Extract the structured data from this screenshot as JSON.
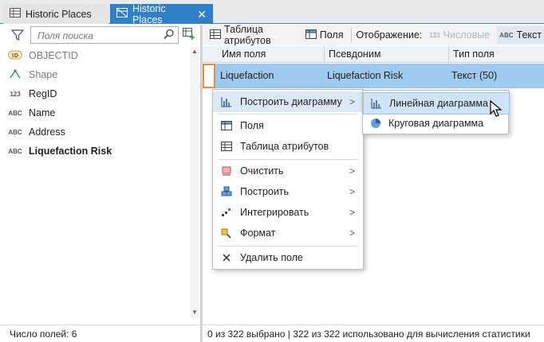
{
  "tabs": [
    {
      "label": "Historic Places",
      "active": false,
      "icon": "table-icon"
    },
    {
      "label": "Historic Places",
      "active": true,
      "icon": "field-view-icon",
      "close": "✕"
    }
  ],
  "left_panel": {
    "search_placeholder": "Поля поиска",
    "fields": [
      {
        "tag": "ID",
        "name": "OBJECTID",
        "style": "dim"
      },
      {
        "tag": "",
        "name": "Shape",
        "style": "dim"
      },
      {
        "tag": "123",
        "name": "RegID",
        "style": "normal"
      },
      {
        "tag": "ABC",
        "name": "Name",
        "style": "normal"
      },
      {
        "tag": "ABC",
        "name": "Address",
        "style": "normal"
      },
      {
        "tag": "ABC",
        "name": "Liquefaction Risk",
        "style": "bold"
      }
    ],
    "status": "Число полей: 6"
  },
  "toolbar": {
    "attribute_table": "Таблица атрибутов",
    "fields": "Поля",
    "display_label": "Отображение:",
    "numeric": "Числовые",
    "numeric_tag": "123",
    "text": "Текст",
    "text_tag": "ABC"
  },
  "grid": {
    "headers": [
      "Имя поля",
      "Псевдоним",
      "Тип поля"
    ],
    "row": [
      "Liquefaction",
      "Liquefaction Risk",
      "Текст (50)"
    ]
  },
  "status_right": "0 из 322 выбрано | 322 из 322 использовано для вычисления статистики",
  "context_menu": {
    "items": [
      {
        "label": "Построить диаграмму",
        "submenu": true,
        "highlight": true
      },
      {
        "label": "Поля"
      },
      {
        "label": "Таблица атрибутов"
      },
      {
        "label": "Очистить",
        "submenu": true
      },
      {
        "label": "Построить",
        "submenu": true
      },
      {
        "label": "Интегрировать",
        "submenu": true
      },
      {
        "label": "Формат",
        "submenu": true
      },
      {
        "label": "Удалить поле"
      }
    ]
  },
  "submenu": {
    "items": [
      {
        "label": "Линейная диаграмма",
        "highlight": true
      },
      {
        "label": "Круговая диаграмма"
      }
    ]
  },
  "colors": {
    "accent": "#2f80c6",
    "row_selected": "#9dcaee",
    "menu_highlight": "#dbe8f5",
    "row_marker": "#f08a3a"
  }
}
